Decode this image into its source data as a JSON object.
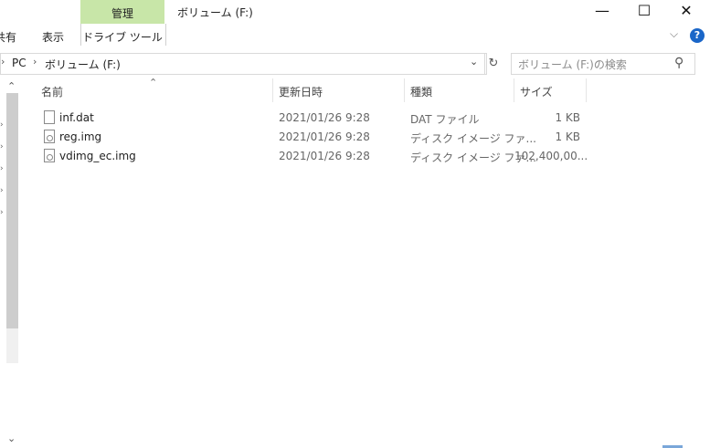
{
  "title_bar": {
    "context_tab": "管理",
    "window_title": "ボリューム (F:)",
    "minimize_glyph": "—",
    "maximize_glyph": "☐",
    "close_glyph": "✕"
  },
  "ribbon": {
    "tabs": [
      "共有",
      "表示"
    ],
    "context_subtab": "ドライブ ツール"
  },
  "address": {
    "crumbs": [
      "PC",
      "ボリューム (F:)"
    ],
    "search_placeholder": "ボリューム (F:)の検索"
  },
  "columns": [
    "名前",
    "更新日時",
    "種類",
    "サイズ"
  ],
  "files": [
    {
      "name": "inf.dat",
      "modified": "2021/01/26 9:28",
      "type": "DAT ファイル",
      "size": "1 KB",
      "icon": "file-icon"
    },
    {
      "name": "reg.img",
      "modified": "2021/01/26 9:28",
      "type": "ディスク イメージ ファ...",
      "size": "1 KB",
      "icon": "disc-image-file-icon"
    },
    {
      "name": "vdimg_ec.img",
      "modified": "2021/01/26 9:28",
      "type": "ディスク イメージ ファ...",
      "size": "102,400,00...",
      "icon": "disc-image-file-icon"
    }
  ],
  "colors": {
    "context_tab": "#c8e6a8",
    "help": "#1a66c8"
  }
}
